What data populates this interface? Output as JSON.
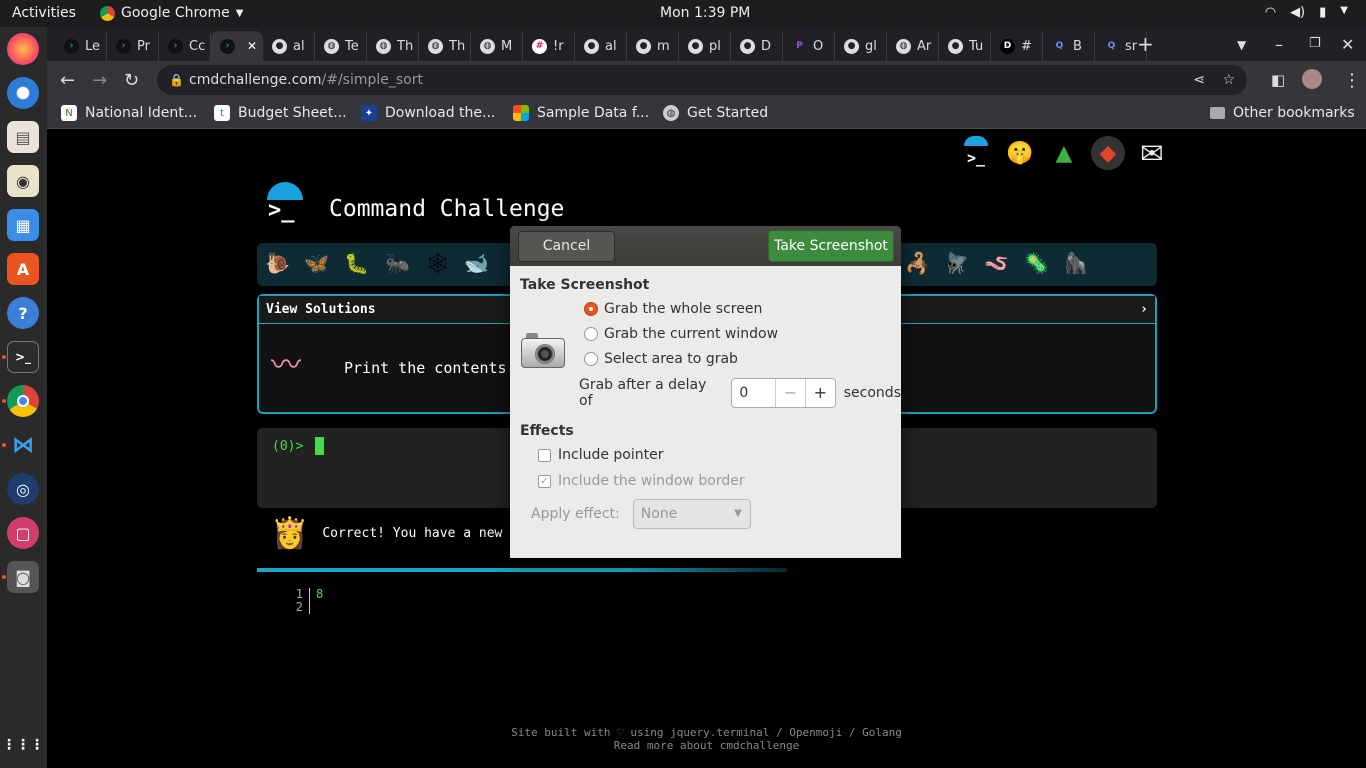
{
  "topbar": {
    "activities": "Activities",
    "app_name": "Google Chrome",
    "clock": "Mon  1:39 PM"
  },
  "tabs": [
    {
      "label": "Le",
      "icon": "cmd-icon"
    },
    {
      "label": "Pr",
      "icon": "cmd-icon"
    },
    {
      "label": "Cc",
      "icon": "cmd-icon"
    },
    {
      "label": "",
      "icon": "cmd-icon",
      "active": true
    },
    {
      "label": "al",
      "icon": "github-icon"
    },
    {
      "label": "Te",
      "icon": "globe-icon"
    },
    {
      "label": "Th",
      "icon": "globe-icon"
    },
    {
      "label": "Th",
      "icon": "globe-icon"
    },
    {
      "label": "M",
      "icon": "globe-icon"
    },
    {
      "label": "!r",
      "icon": "slack-icon"
    },
    {
      "label": "al",
      "icon": "github-icon"
    },
    {
      "label": "m",
      "icon": "github-icon"
    },
    {
      "label": "pl",
      "icon": "github-icon"
    },
    {
      "label": "D",
      "icon": "github-icon"
    },
    {
      "label": "O",
      "icon": "p-icon"
    },
    {
      "label": "gl",
      "icon": "github-icon"
    },
    {
      "label": "Ar",
      "icon": "globe-icon"
    },
    {
      "label": "Tu",
      "icon": "github-icon"
    },
    {
      "label": "#",
      "icon": "dev-icon"
    },
    {
      "label": "B",
      "icon": "search-icon"
    },
    {
      "label": "sr",
      "icon": "search-icon"
    }
  ],
  "address_bar": {
    "host": "cmdchallenge.com",
    "path": "/#/simple_sort"
  },
  "bookmarks": [
    {
      "label": "National Ident..."
    },
    {
      "label": "Budget Sheet..."
    },
    {
      "label": "Download the..."
    },
    {
      "label": "Sample Data f..."
    },
    {
      "label": "Get Started"
    }
  ],
  "other_bookmarks": "Other bookmarks",
  "page": {
    "title": "Command Challenge",
    "view_solutions": "View Solutions",
    "chevron": "›",
    "challenge_text": "Print the contents",
    "prompt": "(0)>",
    "correct_msg": "Correct! You have a new challenge!",
    "line_numbers": [
      "1",
      "2"
    ],
    "output_value": "8",
    "footer_line1": "Site built with ♡ using jquery.terminal / Openmoji / Golang",
    "footer_line2": "Read more about cmdchallenge"
  },
  "dialog": {
    "cancel": "Cancel",
    "take": "Take Screenshot",
    "section_take": "Take Screenshot",
    "opt_whole": "Grab the whole screen",
    "opt_window": "Grab the current window",
    "opt_area": "Select area to grab",
    "delay_label": "Grab after a delay of",
    "delay_value": "0",
    "seconds": "seconds",
    "section_effects": "Effects",
    "include_pointer": "Include pointer",
    "include_border": "Include the window border",
    "apply_effect": "Apply effect:",
    "effect_value": "None"
  }
}
